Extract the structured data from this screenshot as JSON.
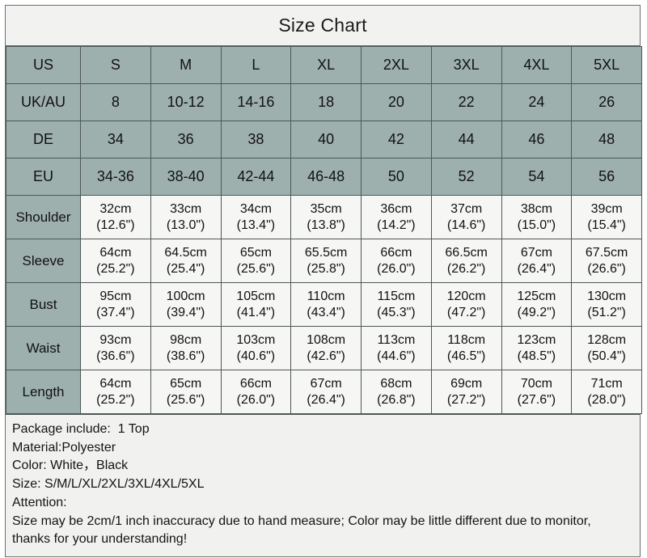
{
  "title": "Size Chart",
  "table": {
    "size_rows": [
      {
        "label": "US",
        "values": [
          "S",
          "M",
          "L",
          "XL",
          "2XL",
          "3XL",
          "4XL",
          "5XL"
        ]
      },
      {
        "label": "UK/AU",
        "values": [
          "8",
          "10-12",
          "14-16",
          "18",
          "20",
          "22",
          "24",
          "26"
        ]
      },
      {
        "label": "DE",
        "values": [
          "34",
          "36",
          "38",
          "40",
          "42",
          "44",
          "46",
          "48"
        ]
      },
      {
        "label": "EU",
        "values": [
          "34-36",
          "38-40",
          "42-44",
          "46-48",
          "50",
          "52",
          "54",
          "56"
        ]
      }
    ],
    "measurement_rows": [
      {
        "label": "Shoulder",
        "cm": [
          "32cm",
          "33cm",
          "34cm",
          "35cm",
          "36cm",
          "37cm",
          "38cm",
          "39cm"
        ],
        "inch": [
          "(12.6\")",
          "(13.0\")",
          "(13.4\")",
          "(13.8\")",
          "(14.2\")",
          "(14.6\")",
          "(15.0\")",
          "(15.4\")"
        ]
      },
      {
        "label": "Sleeve",
        "cm": [
          "64cm",
          "64.5cm",
          "65cm",
          "65.5cm",
          "66cm",
          "66.5cm",
          "67cm",
          "67.5cm"
        ],
        "inch": [
          "(25.2\")",
          "(25.4\")",
          "(25.6\")",
          "(25.8\")",
          "(26.0\")",
          "(26.2\")",
          "(26.4\")",
          "(26.6\")"
        ]
      },
      {
        "label": "Bust",
        "cm": [
          "95cm",
          "100cm",
          "105cm",
          "110cm",
          "115cm",
          "120cm",
          "125cm",
          "130cm"
        ],
        "inch": [
          "(37.4\")",
          "(39.4\")",
          "(41.4\")",
          "(43.4\")",
          "(45.3\")",
          "(47.2\")",
          "(49.2\")",
          "(51.2\")"
        ]
      },
      {
        "label": "Waist",
        "cm": [
          "93cm",
          "98cm",
          "103cm",
          "108cm",
          "113cm",
          "118cm",
          "123cm",
          "128cm"
        ],
        "inch": [
          "(36.6\")",
          "(38.6\")",
          "(40.6\")",
          "(42.6\")",
          "(44.6\")",
          "(46.5\")",
          "(48.5\")",
          "(50.4\")"
        ]
      },
      {
        "label": "Length",
        "cm": [
          "64cm",
          "65cm",
          "66cm",
          "67cm",
          "68cm",
          "69cm",
          "70cm",
          "71cm"
        ],
        "inch": [
          "(25.2\")",
          "(25.6\")",
          "(26.0\")",
          "(26.4\")",
          "(26.8\")",
          "(27.2\")",
          "(27.6\")",
          "(28.0\")"
        ]
      }
    ]
  },
  "notes": {
    "package": "Package include:  1 Top",
    "material": "Material:Polyester",
    "color": "Color: White，Black",
    "size": "Size: S/M/L/XL/2XL/3XL/4XL/5XL",
    "attention_label": "Attention:",
    "attention_body": "Size may be 2cm/1 inch inaccuracy due to hand measure; Color may be little different due to monitor, thanks for your understanding!"
  },
  "colors": {
    "header_teal": "#9db0ae",
    "cell_white": "#f6f6f4",
    "notes_bg": "#f1f1ef",
    "border": "#4d5858",
    "text": "#111111"
  }
}
